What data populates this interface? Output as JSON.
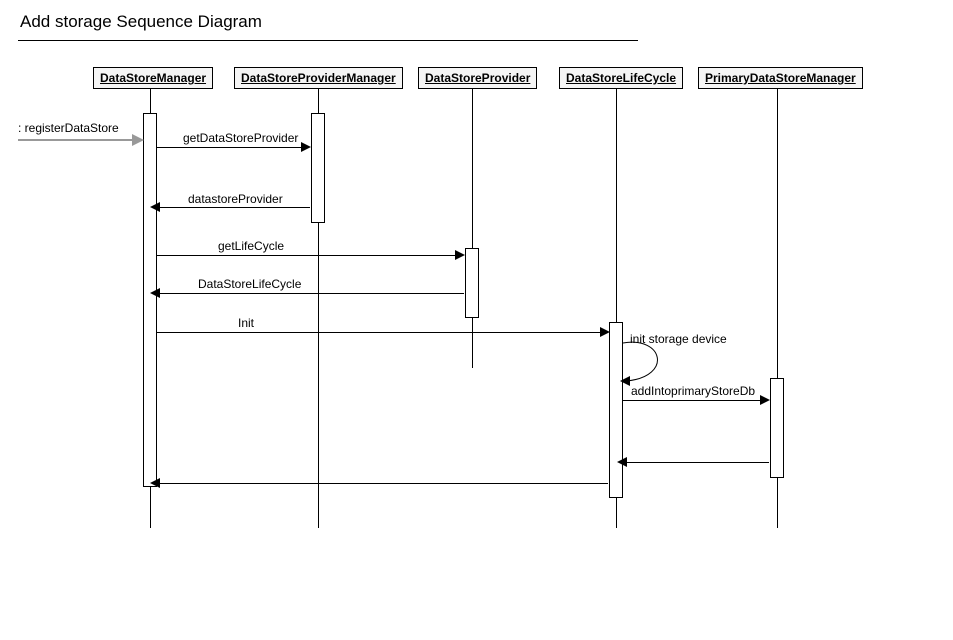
{
  "title": "Add storage Sequence Diagram",
  "participants": {
    "p1": "DataStoreManager",
    "p2": "DataStoreProviderManager",
    "p3": "DataStoreProvider",
    "p4": "DataStoreLifeCycle",
    "p5": "PrimaryDataStoreManager"
  },
  "messages": {
    "m0": ": registerDataStore",
    "m1": "getDataStoreProvider",
    "m2": "datastoreProvider",
    "m3": "getLifeCycle",
    "m4": "DataStoreLifeCycle",
    "m5": "Init",
    "m6": "init storage device",
    "m7": "addIntoprimaryStoreDb"
  }
}
